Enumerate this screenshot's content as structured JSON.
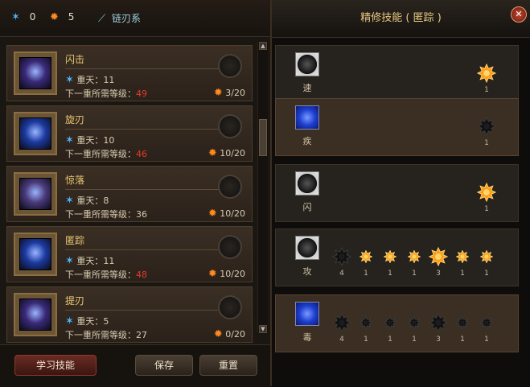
{
  "header": {
    "blue_count": "0",
    "orange_count": "5",
    "class_name": "链刃系"
  },
  "skills": [
    {
      "name": "闪击",
      "layer_label": "重天：11",
      "next_label": "下一重所需等级：",
      "next_level": "49",
      "next_red": true,
      "points": "3/20",
      "theme": "purple"
    },
    {
      "name": "旋刃",
      "layer_label": "重天：10",
      "next_label": "下一重所需等级：",
      "next_level": "46",
      "next_red": true,
      "points": "10/20",
      "theme": "blue"
    },
    {
      "name": "惊落",
      "layer_label": "重天：8",
      "next_label": "下一重所需等级：",
      "next_level": "36",
      "next_red": false,
      "points": "10/20",
      "theme": "violet"
    },
    {
      "name": "匿踪",
      "layer_label": "重天：11",
      "next_label": "下一重所需等级：",
      "next_level": "48",
      "next_red": true,
      "points": "10/20",
      "theme": "blue"
    },
    {
      "name": "提刃",
      "layer_label": "重天：5",
      "next_label": "下一重所需等级：",
      "next_level": "27",
      "next_red": false,
      "points": "0/20",
      "theme": "purple"
    }
  ],
  "buttons": {
    "learn": "学习技能",
    "save": "保存",
    "reset": "重置"
  },
  "panel": {
    "title": "精修技能 ( 匿踪 )",
    "close": "✕",
    "rows": [
      {
        "label": "速",
        "icon": "gray",
        "nodes": [
          {
            "count": "1",
            "active": true,
            "big": true
          }
        ]
      },
      {
        "label": "疾",
        "icon": "blue",
        "nodes": [
          {
            "count": "1",
            "active": false,
            "big": true
          }
        ]
      },
      {
        "label": "闪",
        "icon": "gray",
        "nodes": [
          {
            "count": "1",
            "active": true,
            "big": true
          }
        ]
      },
      {
        "label": "攻",
        "icon": "gray",
        "nodes": [
          {
            "count": "4",
            "active": false,
            "big": true
          },
          {
            "count": "1",
            "active": true,
            "big": false
          },
          {
            "count": "1",
            "active": true,
            "big": false
          },
          {
            "count": "1",
            "active": true,
            "big": false
          },
          {
            "count": "3",
            "active": true,
            "big": true
          },
          {
            "count": "1",
            "active": true,
            "big": false
          },
          {
            "count": "1",
            "active": true,
            "big": false
          }
        ]
      },
      {
        "label": "毒",
        "icon": "blue",
        "nodes": [
          {
            "count": "4",
            "active": false,
            "big": true
          },
          {
            "count": "1",
            "active": false,
            "big": false
          },
          {
            "count": "1",
            "active": false,
            "big": false
          },
          {
            "count": "1",
            "active": false,
            "big": false
          },
          {
            "count": "3",
            "active": false,
            "big": true
          },
          {
            "count": "1",
            "active": false,
            "big": false
          },
          {
            "count": "1",
            "active": false,
            "big": false
          }
        ]
      }
    ]
  },
  "colors": {
    "gold_text": "#e9c774",
    "red_level": "#e23a2a",
    "blue_star": "#4fb8ff",
    "orange_star": "#ff8a1e"
  }
}
